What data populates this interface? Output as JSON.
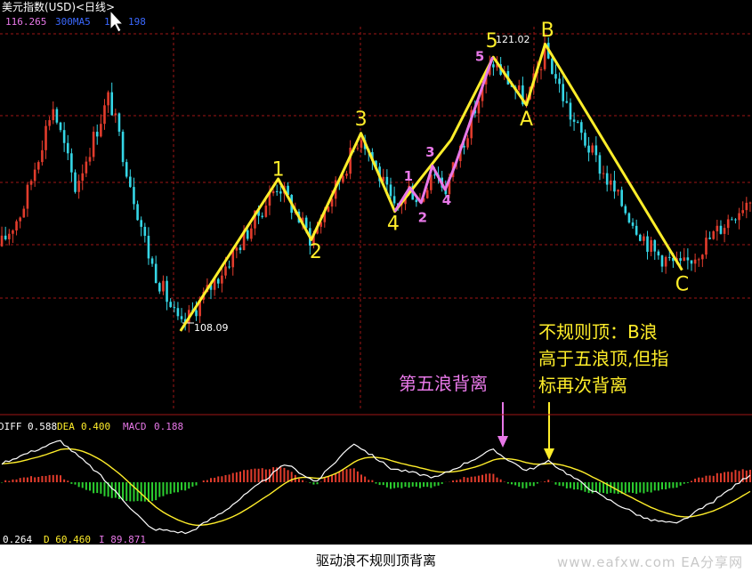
{
  "chart_data": [
    {
      "type": "candlestick",
      "panel": "price",
      "title": "美元指数(USD)<日线>",
      "legend_values": [
        "116.265",
        "300MA5",
        "1",
        "198"
      ],
      "colors": {
        "up": "#e23c2c",
        "down": "#35d6e6",
        "wave": "#ffee2a",
        "subwave": "#e878e8",
        "grid": "#a01616",
        "background": "#000000"
      },
      "ylim": [
        104.8,
        122.4
      ],
      "low_label": "108.09",
      "high_label": "121.02",
      "wave_path": [
        [
          0.24,
          108.4
        ],
        [
          0.37,
          115.4
        ],
        [
          0.414,
          112.6
        ],
        [
          0.48,
          117.5
        ],
        [
          0.525,
          113.9
        ],
        [
          0.6,
          117.2
        ],
        [
          0.656,
          121.0
        ],
        [
          0.7,
          118.8
        ],
        [
          0.725,
          121.6
        ],
        [
          0.907,
          111.2
        ]
      ],
      "wave_labels": [
        {
          "text": "1",
          "x": 0.37,
          "y": 115.8
        },
        {
          "text": "2",
          "x": 0.42,
          "y": 112.0
        },
        {
          "text": "3",
          "x": 0.48,
          "y": 118.1
        },
        {
          "text": "4",
          "x": 0.523,
          "y": 113.3
        },
        {
          "text": "5",
          "x": 0.654,
          "y": 121.7
        },
        {
          "text": "A",
          "x": 0.7,
          "y": 118.1
        },
        {
          "text": "B",
          "x": 0.728,
          "y": 122.2
        },
        {
          "text": "C",
          "x": 0.907,
          "y": 110.5
        }
      ],
      "subwave_path": [
        [
          0.525,
          113.9
        ],
        [
          0.545,
          115.0
        ],
        [
          0.56,
          114.3
        ],
        [
          0.575,
          116.0
        ],
        [
          0.592,
          114.9
        ],
        [
          0.605,
          116.0
        ],
        [
          0.655,
          121.0
        ]
      ],
      "subwave_labels": [
        {
          "text": "1",
          "x": 0.543,
          "y": 115.5
        },
        {
          "text": "2",
          "x": 0.562,
          "y": 113.6
        },
        {
          "text": "3",
          "x": 0.572,
          "y": 116.6
        },
        {
          "text": "4",
          "x": 0.594,
          "y": 114.4
        },
        {
          "text": "5",
          "x": 0.638,
          "y": 121.0
        }
      ],
      "annotations": [
        {
          "text": "第五浪背离",
          "color": "#e878e8"
        },
        {
          "lines": [
            "不规则顶：B浪",
            "高于五浪顶,但指",
            "标再次背离"
          ],
          "color": "#ffee2a"
        }
      ]
    },
    {
      "type": "macd",
      "panel": "indicator",
      "legend": [
        {
          "label": "DIFF",
          "value": "0.588",
          "color": "#ffffff"
        },
        {
          "label": "DEA",
          "value": "0.400",
          "color": "#ffee2a"
        },
        {
          "label": "MACD",
          "value": "0.188",
          "color": "#e878e8"
        }
      ],
      "bottom_readout": [
        "0.264",
        "D 60.460",
        "I 89.871"
      ]
    }
  ],
  "caption": "驱动浪不规则顶背离",
  "watermark": "www.eafxw.com EA分享网"
}
